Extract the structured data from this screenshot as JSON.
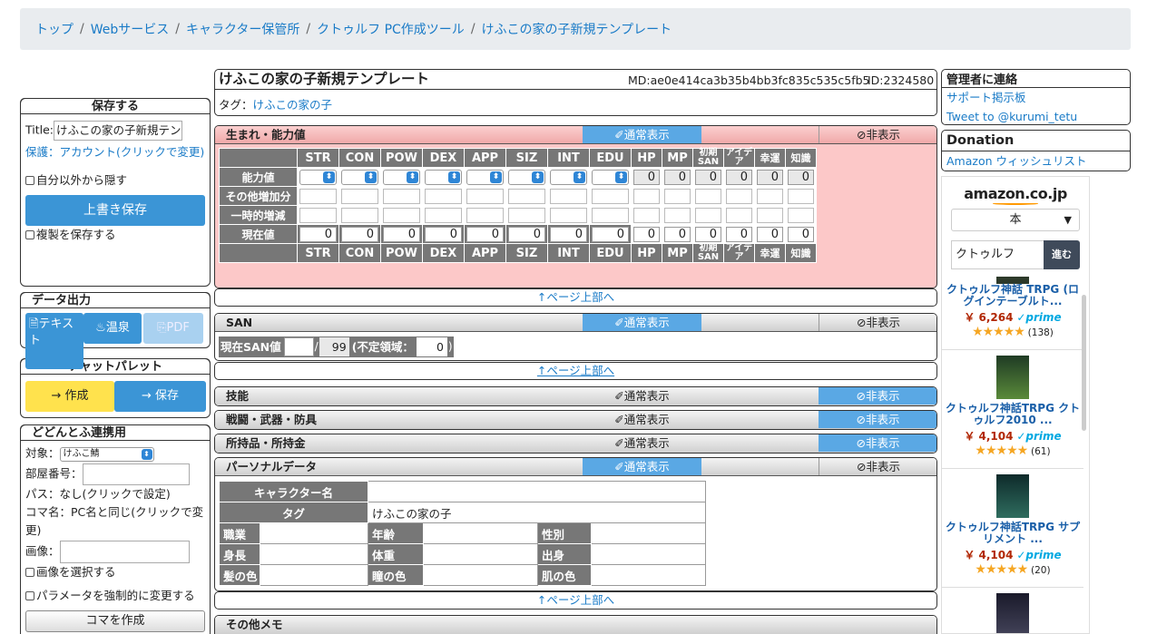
{
  "breadcrumb": [
    "トップ",
    "Webサービス",
    "キャラクター保管所",
    "クトゥルフ PC作成ツール",
    "けふこの家の子新規テンプレート"
  ],
  "save": {
    "title": "保存する",
    "title_label": "Title:",
    "title_value": "けふこの家の子新規テンプ",
    "protect": "保護：アカウント(クリックで変更)",
    "hide_others": "自分以外から隠す",
    "overwrite": "上書き保存",
    "save_copy": "複製を保存する"
  },
  "export": {
    "title": "データ出力",
    "text": "テキスト",
    "onsen": "温泉",
    "pdf": "PDF"
  },
  "chatpalette": {
    "title": "チャットパレット",
    "create": "→ 作成",
    "save": "→ 保存"
  },
  "dodontof": {
    "title": "どどんとふ連携用",
    "target_label": "対象：",
    "target_value": "けふこ鯖",
    "room_label": "部屋番号：",
    "pass": "パス：なし(クリックで設定)",
    "piece_name": "コマ名：PC名と同じ(クリックで変更)",
    "image_label": "画像：",
    "select_image": "画像を選択する",
    "force_params": "パラメータを強制的に変更する",
    "create_piece": "コマを作成"
  },
  "sheet": {
    "name": "けふこの家の子新規テンプレート",
    "md": "MD:ae0e414ca3b35b4bb3fc835c535c5fb5",
    "id": "ID:2324580",
    "tag_label": "タグ：",
    "tag": "けふこの家の子"
  },
  "toggles": {
    "normal": "✐通常表示",
    "hidden": "⊘非表示"
  },
  "page_top": "↑ページ上部へ",
  "abilities": {
    "title": "生まれ・能力値",
    "headers": [
      "STR",
      "CON",
      "POW",
      "DEX",
      "APP",
      "SIZ",
      "INT",
      "EDU",
      "HP",
      "MP",
      "初期SAN",
      "アイデア",
      "幸運",
      "知識"
    ],
    "rows": [
      "能力値",
      "その他増加分",
      "一時的増減",
      "現在値"
    ],
    "derived_values": [
      "0",
      "0",
      "0",
      "0",
      "0",
      "0"
    ],
    "current_values": [
      "0",
      "0",
      "0",
      "0",
      "0",
      "0",
      "0",
      "0",
      "0",
      "0",
      "0",
      "0",
      "0",
      "0"
    ]
  },
  "san": {
    "title": "SAN",
    "current_label": "現在SAN値",
    "max": "99",
    "indef_label": "(不定領域：",
    "indef_value": "0"
  },
  "sections": {
    "skills": "技能",
    "combat": "戦闘・武器・防具",
    "items": "所持品・所持金",
    "personal": "パーソナルデータ",
    "memo": "その他メモ"
  },
  "personal": {
    "char_name_label": "キャラクター名",
    "tag_label": "タグ",
    "tag_value": "けふこの家の子",
    "job": "職業",
    "age": "年齢",
    "sex": "性別",
    "height": "身長",
    "weight": "体重",
    "origin": "出身",
    "hair": "髪の色",
    "eye": "瞳の色",
    "skin": "肌の色"
  },
  "contact": {
    "title": "管理者に連絡",
    "board": "サポート掲示板",
    "tweet": "Tweet to @kurumi_tetu"
  },
  "donation": {
    "title": "Donation",
    "wishlist": "Amazon ウィッシュリスト"
  },
  "amazon": {
    "logo": "amazon.co.jp",
    "category": "本",
    "search_value": "クトゥルフ",
    "go": "進む",
    "products": [
      {
        "title": "クトゥルフ神話 TRPG (ログインテーブルト...",
        "price": "￥ 6,264",
        "prime": "✓prime",
        "stars": "★★★★★",
        "reviews": "(138)"
      },
      {
        "title": "クトゥルフ神話TRPG クトゥルフ2010 ...",
        "price": "￥ 4,104",
        "prime": "✓prime",
        "stars": "★★★★★",
        "reviews": "(61)"
      },
      {
        "title": "クトゥルフ神話TRPG サプリメント ...",
        "price": "￥ 4,104",
        "prime": "✓prime",
        "stars": "★★★★★",
        "reviews": "(20)"
      }
    ]
  }
}
